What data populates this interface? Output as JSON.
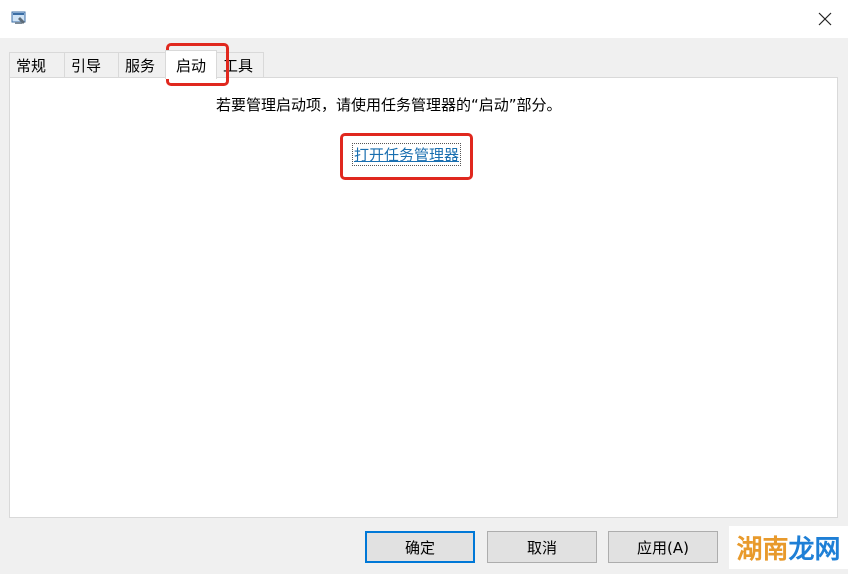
{
  "window": {
    "close_glyph": "✕"
  },
  "tabs": [
    {
      "label": "常规",
      "active": false
    },
    {
      "label": "引导",
      "active": false
    },
    {
      "label": "服务",
      "active": false
    },
    {
      "label": "启动",
      "active": true
    },
    {
      "label": "工具",
      "active": false
    }
  ],
  "startup": {
    "hint": "若要管理启动项，请使用任务管理器的“启动”部分。",
    "link": "打开任务管理器"
  },
  "buttons": {
    "ok": "确定",
    "cancel": "取消",
    "apply": "应用(A)"
  },
  "watermark": {
    "part1": "湖南",
    "part2": "龙网"
  },
  "colors": {
    "highlight": "#e0281e",
    "link": "#1a6fb0",
    "focus": "#0078d7"
  }
}
